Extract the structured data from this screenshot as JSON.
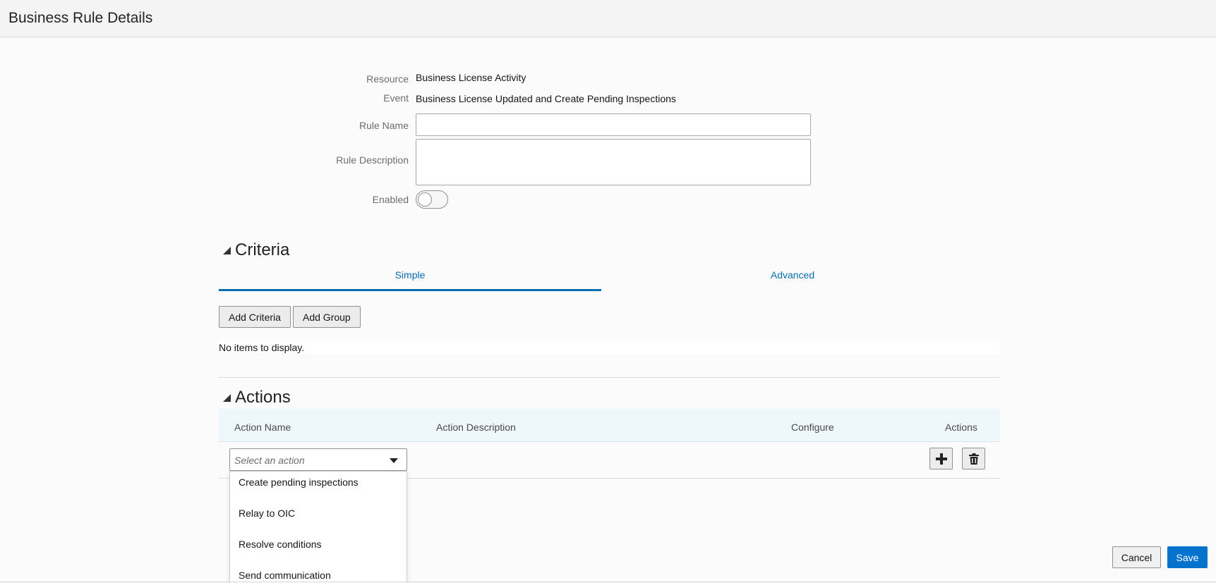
{
  "header": {
    "title": "Business Rule Details"
  },
  "form": {
    "resource_label": "Resource",
    "resource_value": "Business License Activity",
    "event_label": "Event",
    "event_value": "Business License Updated and Create Pending Inspections",
    "rule_name_label": "Rule Name",
    "rule_name_value": "",
    "rule_description_label": "Rule Description",
    "rule_description_value": "",
    "enabled_label": "Enabled",
    "enabled": false
  },
  "criteria": {
    "title": "Criteria",
    "tabs": [
      {
        "label": "Simple",
        "active": true
      },
      {
        "label": "Advanced",
        "active": false
      }
    ],
    "add_criteria_label": "Add Criteria",
    "add_group_label": "Add Group",
    "empty_text": "No items to display."
  },
  "actions": {
    "title": "Actions",
    "columns": [
      "Action Name",
      "Action Description",
      "Configure",
      "Actions"
    ],
    "select_placeholder": "Select an action",
    "options": [
      "Create pending inspections",
      "Relay to OIC",
      "Resolve conditions",
      "Send communication"
    ],
    "add_icon": "plus-icon",
    "delete_icon": "trash-icon"
  },
  "footer": {
    "cancel_label": "Cancel",
    "save_label": "Save"
  },
  "colors": {
    "accent": "#0572ce",
    "tab_link": "#0b6db1",
    "table_header_bg": "#eef7fb"
  }
}
